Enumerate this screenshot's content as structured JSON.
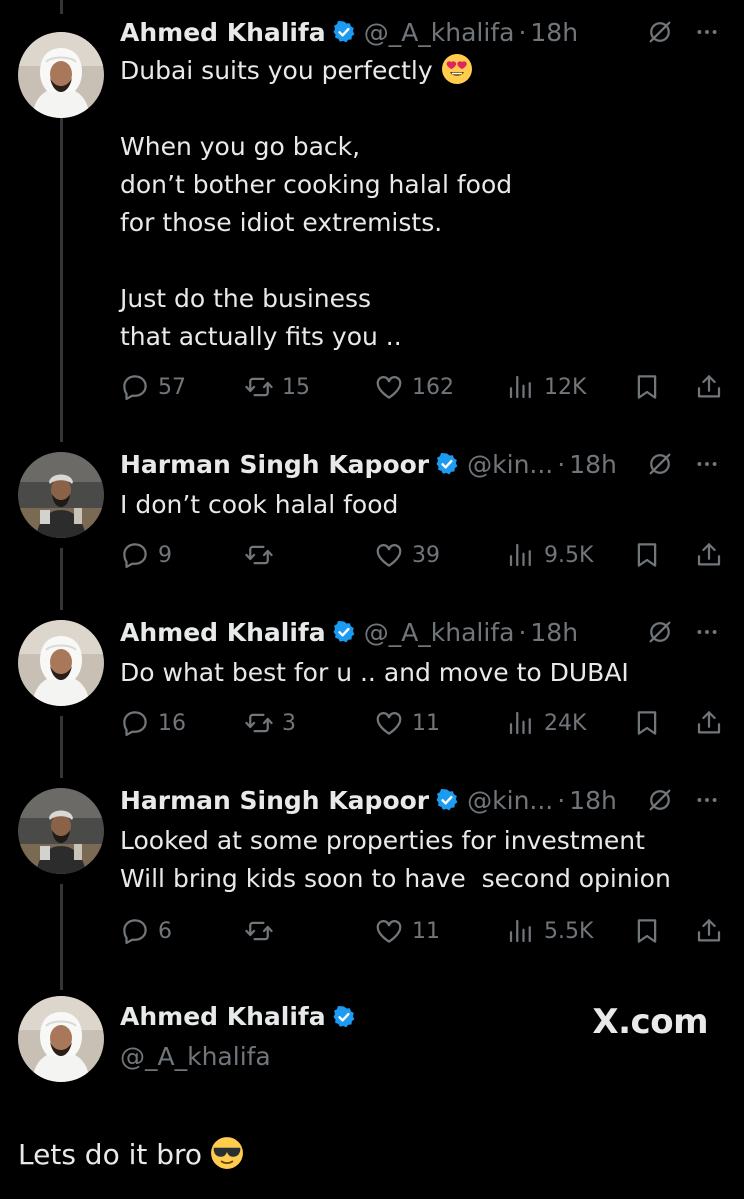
{
  "colors": {
    "background": "#000000",
    "text": "#e7e9ea",
    "muted": "#71767b",
    "verified": "#1d9bf0",
    "thread_line": "#333639"
  },
  "tweets": [
    {
      "author": "Ahmed Khalifa",
      "handle": "@_A_khalifa",
      "time": "18h",
      "lines": [
        "Dubai suits you perfectly",
        "",
        "When you go back,",
        "don’t bother cooking halal food",
        "for those idiot extremists.",
        "",
        "Just do the business",
        "that actually fits you .."
      ],
      "emoji": "heart-eyes-emoji",
      "replies": "57",
      "reposts": "15",
      "likes": "162",
      "views": "12K"
    },
    {
      "author": "Harman Singh Kapoor",
      "handle": "@kin...",
      "time": "18h",
      "lines": [
        "I don’t cook halal food"
      ],
      "replies": "9",
      "reposts": "",
      "likes": "39",
      "views": "9.5K"
    },
    {
      "author": "Ahmed Khalifa",
      "handle": "@_A_khalifa",
      "time": "18h",
      "lines": [
        "Do what best for u .. and move to DUBAI"
      ],
      "replies": "16",
      "reposts": "3",
      "likes": "11",
      "views": "24K"
    },
    {
      "author": "Harman Singh Kapoor",
      "handle": "@kin...",
      "time": "18h",
      "lines": [
        "Looked at some properties for investment",
        "Will bring kids soon to have  second opinion"
      ],
      "replies": "6",
      "reposts": "",
      "likes": "11",
      "views": "5.5K"
    }
  ],
  "final": {
    "author": "Ahmed Khalifa",
    "handle": "@_A_khalifa",
    "brand": "X.com",
    "text": "Lets do it bro",
    "emoji": "sunglasses-emoji"
  },
  "icons": [
    "reply-icon",
    "repost-icon",
    "like-icon",
    "views-icon",
    "bookmark-icon",
    "share-icon",
    "grok-icon",
    "more-icon",
    "verified-icon"
  ]
}
